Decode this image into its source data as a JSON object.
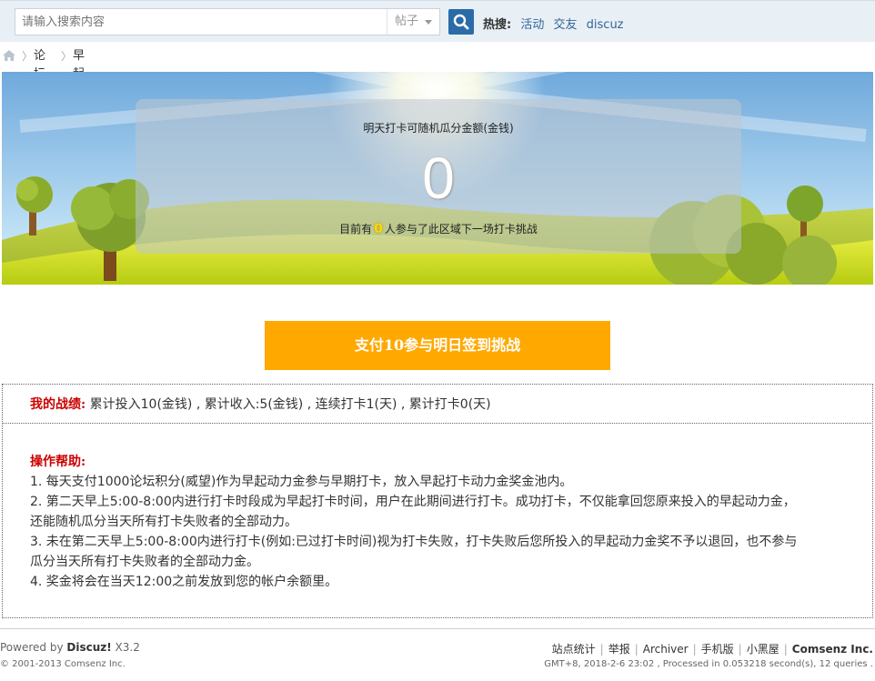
{
  "search": {
    "placeholder": "请输入搜索内容",
    "type_label": "帖子",
    "hot_label": "热搜:",
    "hot_links": [
      "活动",
      "交友",
      "discuz"
    ]
  },
  "breadcrumb": {
    "items": [
      "论坛",
      "早起挑战团"
    ]
  },
  "banner": {
    "title": "明天打卡可随机瓜分金额(金钱)",
    "amount": "0",
    "sub_prefix": "目前有",
    "participants": "0",
    "sub_suffix": "人参与了此区域下一场打卡挑战"
  },
  "cta": {
    "label": "支付10参与明日签到挑战"
  },
  "record": {
    "label": "我的战绩:",
    "text": "累计投入10(金钱) , 累计收入:5(金钱) , 连续打卡1(天) , 累计打卡0(天)"
  },
  "help": {
    "title": "操作帮助:",
    "lines": [
      "1. 每天支付1000论坛积分(威望)作为早起动力金参与早期打卡，放入早起打卡动力金奖金池内。",
      "2. 第二天早上5:00-8:00内进行打卡时段成为早起打卡时间，用户在此期间进行打卡。成功打卡，不仅能拿回您原来投入的早起动力金，",
      "还能随机瓜分当天所有打卡失败者的全部动力。",
      "3. 未在第二天早上5:00-8:00内进行打卡(例如:已过打卡时间)视为打卡失败，打卡失败后您所投入的早起动力金奖不予以退回，也不参与",
      "瓜分当天所有打卡失败者的全部动力金。",
      "4. 奖金将会在当天12:00之前发放到您的帐户余额里。"
    ]
  },
  "footer": {
    "powered_prefix": "Powered by ",
    "powered_brand": "Discuz!",
    "powered_version": " X3.2",
    "copyright": "© 2001-2013 Comsenz Inc.",
    "links": [
      "站点统计",
      "举报",
      "Archiver",
      "手机版",
      "小黑屋",
      "Comsenz Inc."
    ],
    "gmt": "GMT+8, 2018-2-6 23:02 , Processed in 0.053218 second(s), 12 queries ."
  },
  "colors": {
    "accent": "#ffa800",
    "link": "#336699",
    "alert": "#cc0000",
    "search_button": "#2b6ba8"
  }
}
